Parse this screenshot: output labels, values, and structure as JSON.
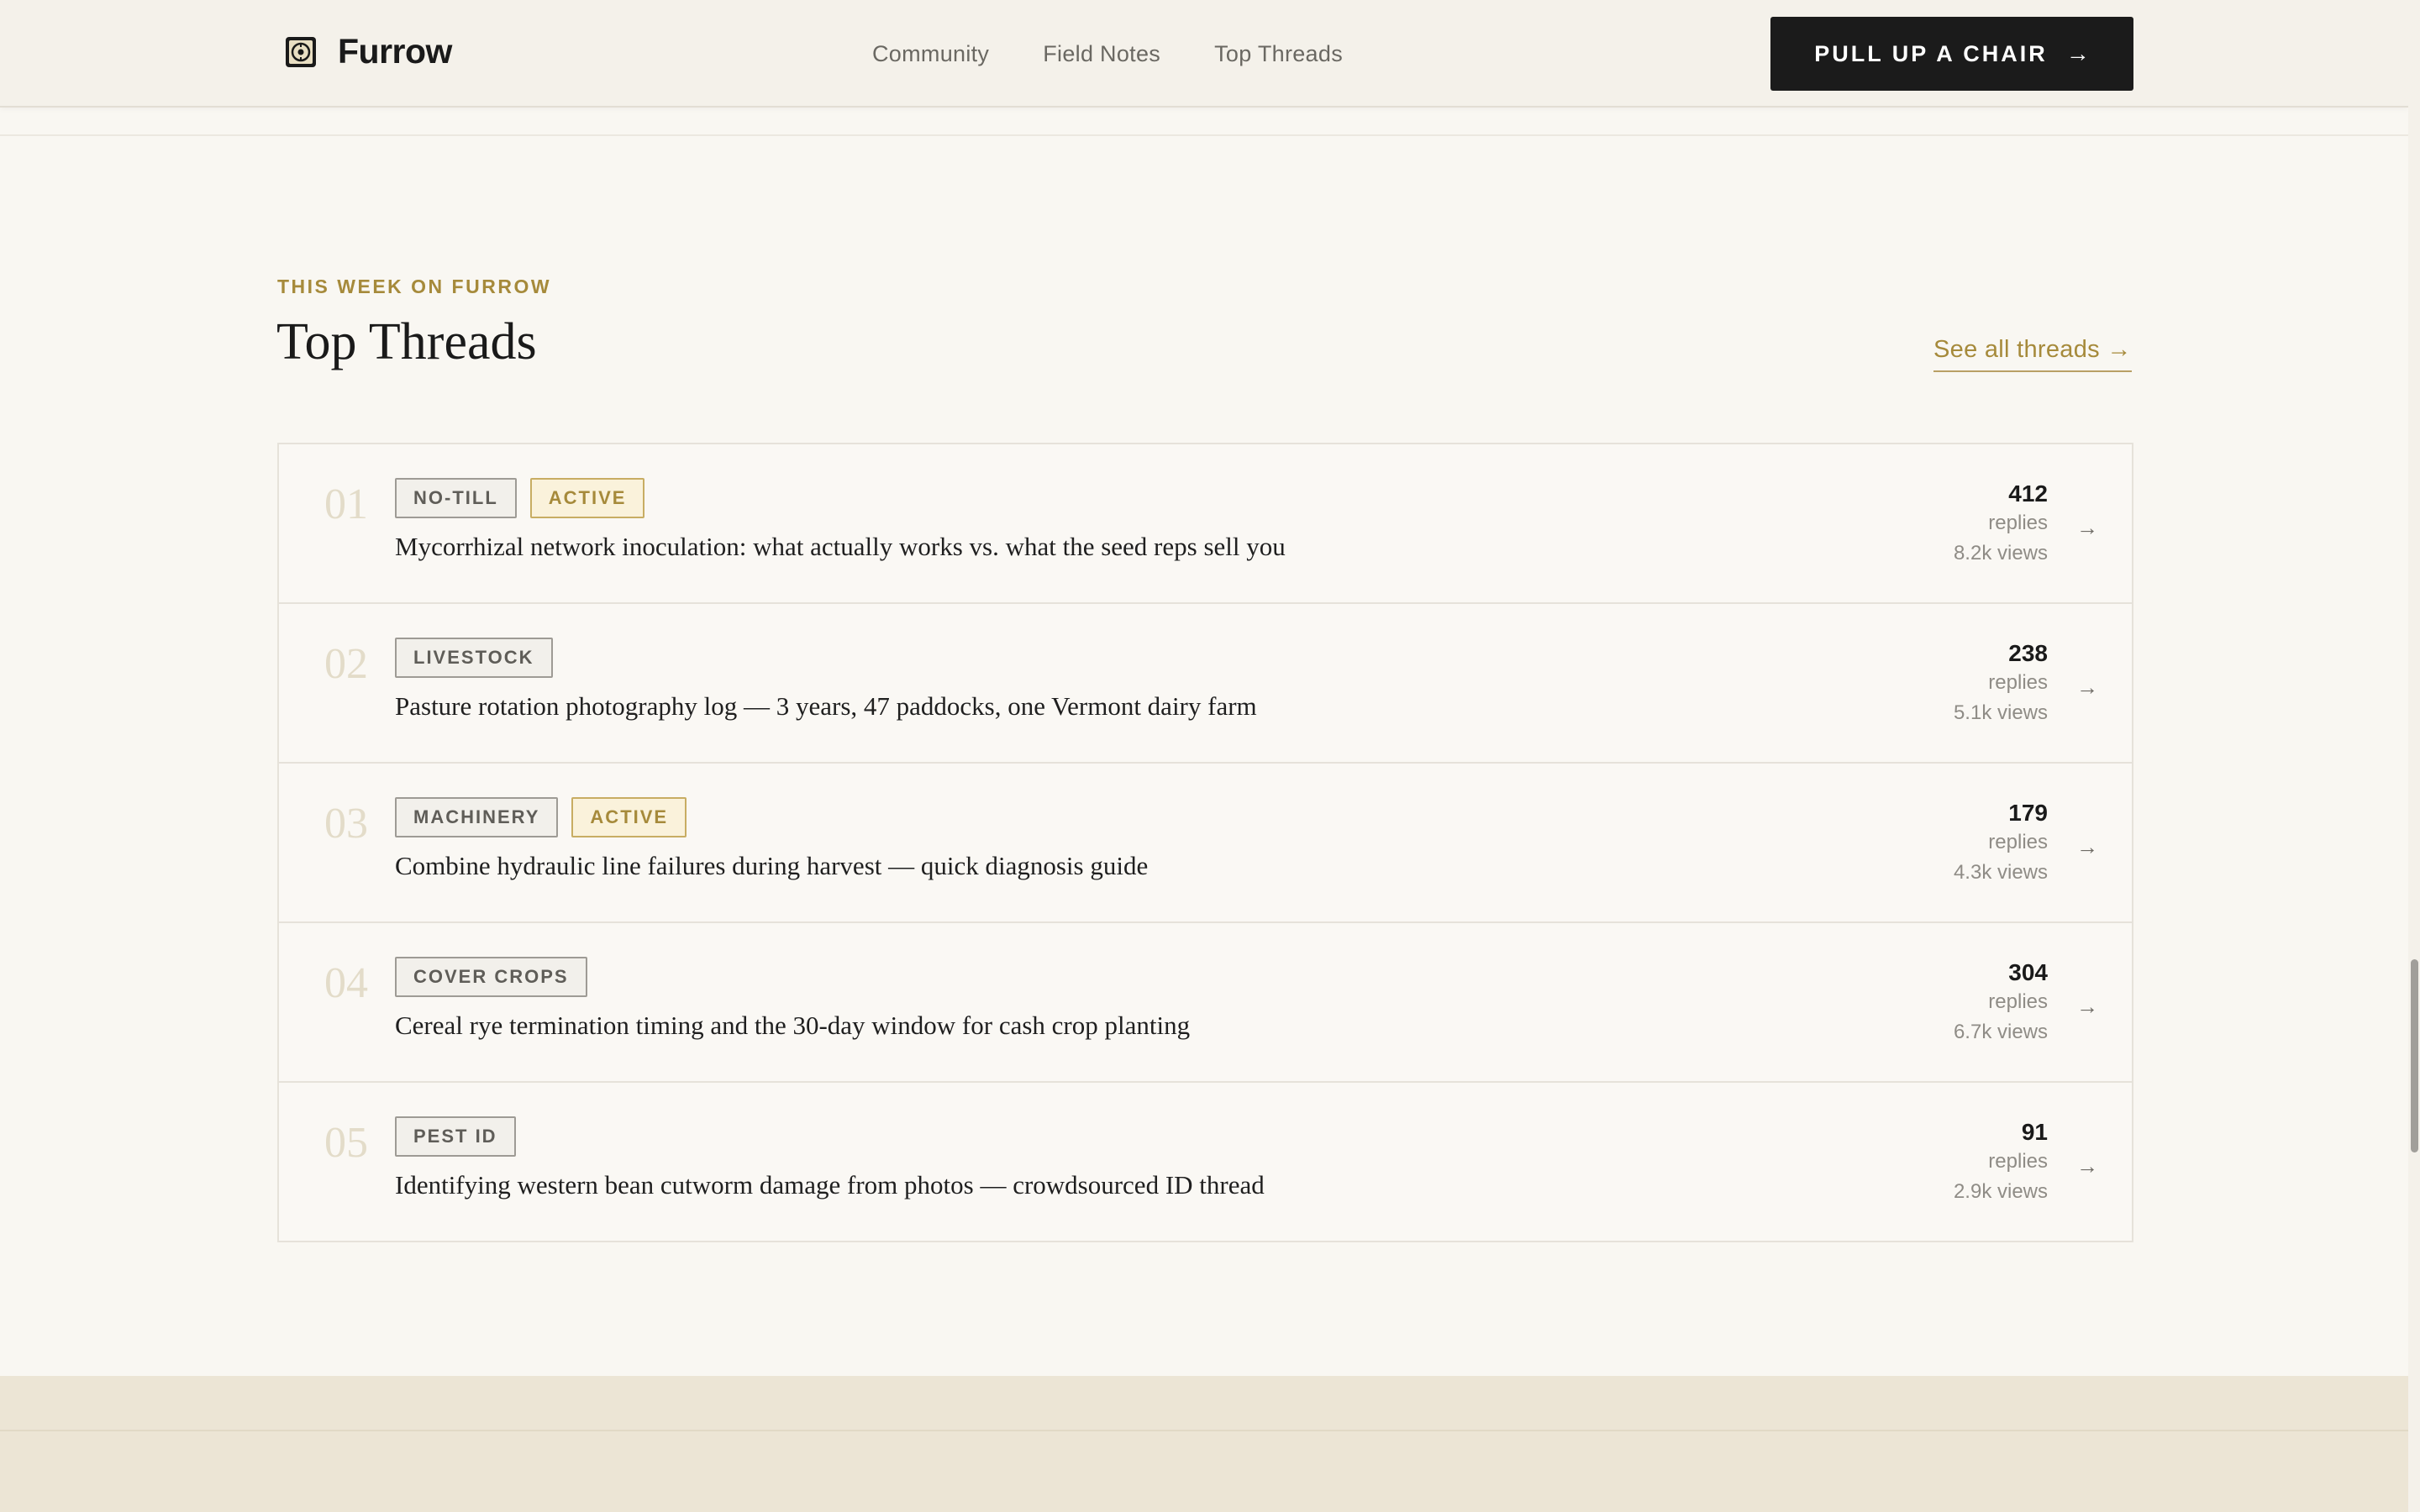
{
  "brand": {
    "name": "Furrow",
    "icon": "seed-badge-icon"
  },
  "nav": {
    "items": [
      "Community",
      "Field Notes",
      "Top Threads"
    ]
  },
  "cta": {
    "label": "PULL UP A CHAIR",
    "arrow": "→"
  },
  "section": {
    "eyebrow": "THIS WEEK ON FURROW",
    "title": "Top Threads",
    "see_all": "See all threads →"
  },
  "threads": [
    {
      "rank": "01",
      "tags": [
        {
          "label": "NO-TILL",
          "active": false
        },
        {
          "label": "ACTIVE",
          "active": true
        }
      ],
      "title": "Mycorrhizal network inoculation: what actually works vs. what the seed reps sell you",
      "replies": "412",
      "replies_label": "replies",
      "views": "8.2k views"
    },
    {
      "rank": "02",
      "tags": [
        {
          "label": "LIVESTOCK",
          "active": false
        }
      ],
      "title": "Pasture rotation photography log — 3 years, 47 paddocks, one Vermont dairy farm",
      "replies": "238",
      "replies_label": "replies",
      "views": "5.1k views"
    },
    {
      "rank": "03",
      "tags": [
        {
          "label": "MACHINERY",
          "active": false
        },
        {
          "label": "ACTIVE",
          "active": true
        }
      ],
      "title": "Combine hydraulic line failures during harvest — quick diagnosis guide",
      "replies": "179",
      "replies_label": "replies",
      "views": "4.3k views"
    },
    {
      "rank": "04",
      "tags": [
        {
          "label": "COVER CROPS",
          "active": false
        }
      ],
      "title": "Cereal rye termination timing and the 30-day window for cash crop planting",
      "replies": "304",
      "replies_label": "replies",
      "views": "6.7k views"
    },
    {
      "rank": "05",
      "tags": [
        {
          "label": "PEST ID",
          "active": false
        }
      ],
      "title": "Identifying western bean cutworm damage from photos — crowdsourced ID thread",
      "replies": "91",
      "replies_label": "replies",
      "views": "2.9k views"
    }
  ],
  "row_arrow": "→",
  "colors": {
    "accent": "#a68a3b",
    "cta_bg": "#1b1b1b",
    "page_bg": "#f9f7f2",
    "footer_bg": "#ece5d5"
  }
}
